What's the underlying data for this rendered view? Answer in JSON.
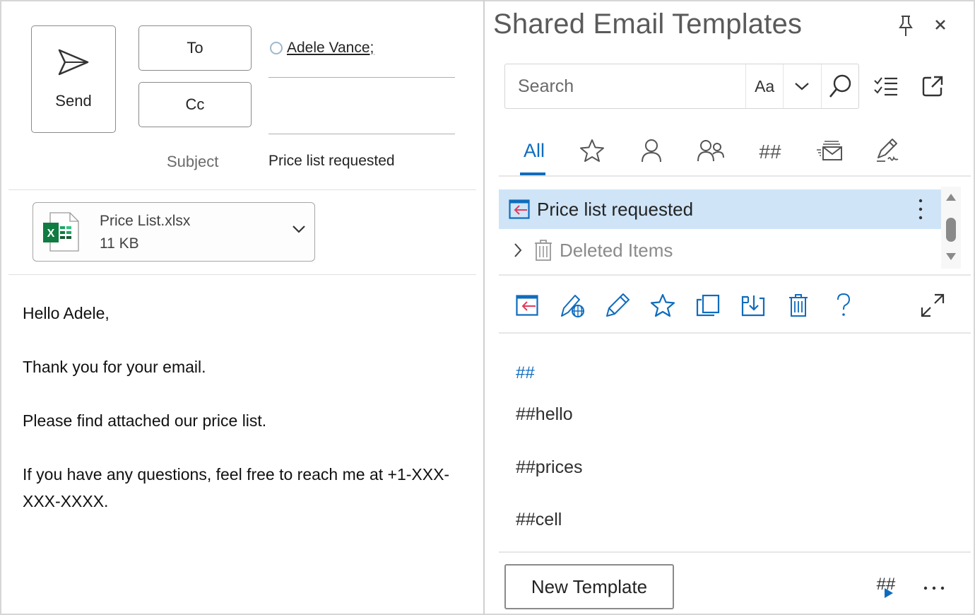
{
  "compose": {
    "send_label": "Send",
    "to_label": "To",
    "cc_label": "Cc",
    "recipients": [
      {
        "name": "Adele Vance;"
      }
    ],
    "cc_value": "",
    "subject_label": "Subject",
    "subject_value": "Price list requested",
    "attachment": {
      "name": "Price List.xlsx",
      "size": "11 KB",
      "type_icon": "excel-file-icon"
    },
    "body": [
      "Hello Adele,",
      "Thank you for your email.",
      "Please find attached our price list.",
      "If you have any questions, feel free to reach me at +1-XXX-XXX-XXXX."
    ]
  },
  "panel": {
    "title": "Shared Email Templates",
    "search": {
      "placeholder": "Search",
      "value": "",
      "match_case_label": "Aa"
    },
    "tabs": [
      {
        "label": "All",
        "icon": null,
        "active": true
      },
      {
        "label": "",
        "icon": "star-icon"
      },
      {
        "label": "",
        "icon": "person-icon"
      },
      {
        "label": "",
        "icon": "people-icon"
      },
      {
        "label": "",
        "icon": "macros-icon"
      },
      {
        "label": "",
        "icon": "mail-stack-icon"
      },
      {
        "label": "",
        "icon": "signature-icon"
      }
    ],
    "tree": [
      {
        "label": "Price list requested",
        "icon": "insert-template-icon",
        "selected": true
      },
      {
        "label": "Deleted Items",
        "icon": "trash-icon",
        "collapsed": true
      }
    ],
    "toolbar": [
      "insert-template-icon",
      "edit-online-icon",
      "edit-icon",
      "favorite-icon",
      "copy-icon",
      "move-icon",
      "delete-icon",
      "help-icon"
    ],
    "macros": {
      "header": "##",
      "items": [
        "##hello",
        "##prices",
        "##cell"
      ]
    },
    "new_template_label": "New Template",
    "accent_color": "#0f6cbd",
    "selected_row_color": "#cfe4f7"
  }
}
